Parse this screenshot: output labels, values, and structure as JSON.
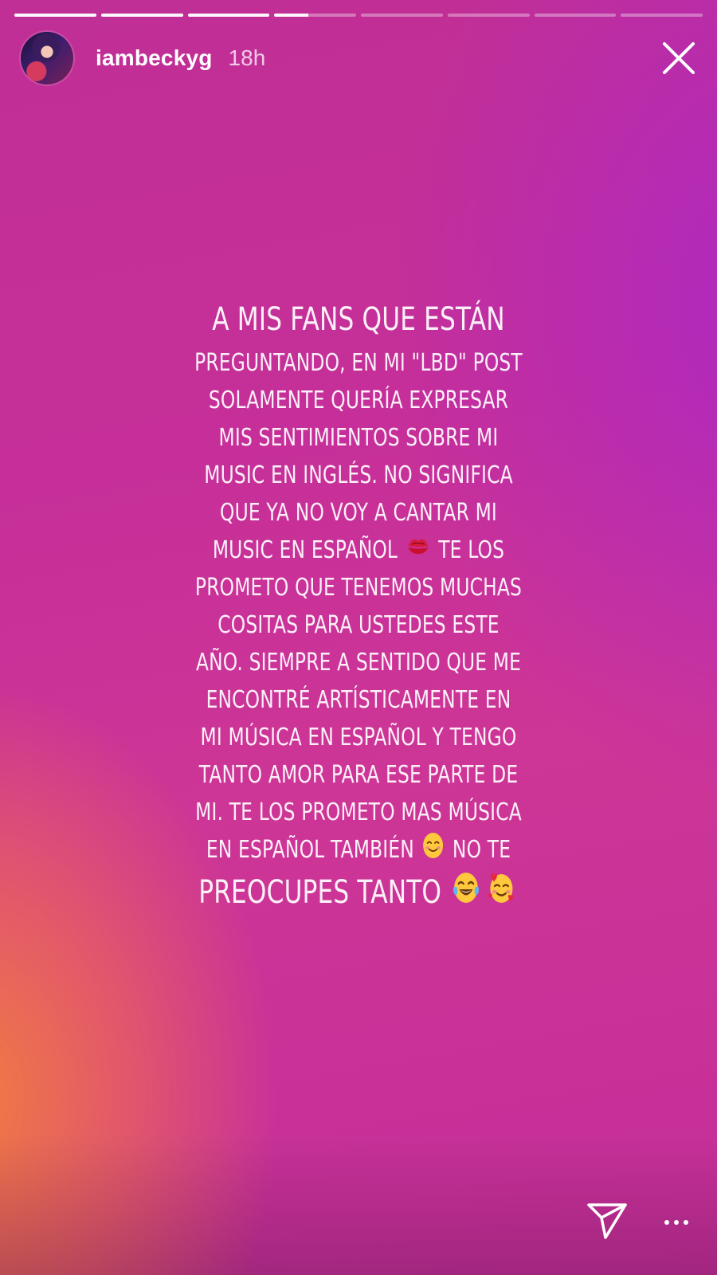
{
  "story": {
    "progress": {
      "segments": 8,
      "current_index": 3,
      "current_fraction": 0.42
    },
    "header": {
      "username": "iambeckyg",
      "time_ago": "18h"
    },
    "text_lines": [
      "A MIS FANS QUE ESTÁN",
      "PREGUNTANDO, EN MI \"LBD\" POST",
      "SOLAMENTE QUERÍA EXPRESAR",
      "MIS SENTIMIENTOS SOBRE MI",
      "MUSIC EN INGLÉS. NO SIGNIFICA",
      "QUE YA NO VOY A CANTAR MI",
      "MUSIC EN ESPAÑOL",
      "TE LOS",
      "PROMETO QUE TENEMOS MUCHAS",
      "COSITAS PARA USTEDES ESTE",
      "AÑO. SIEMPRE A SENTIDO QUE ME",
      "ENCONTRÉ ARTÍSTICAMENTE EN",
      "MI MÚSICA EN ESPAÑOL Y TENGO",
      "TANTO AMOR PARA ESE PARTE DE",
      "MI. TE LOS PROMETO MAS MÚSICA",
      "EN ESPAÑOL TAMBIÉN",
      "NO TE",
      "PREOCUPES TANTO"
    ],
    "emojis": {
      "kiss": "kiss-mark-icon",
      "smiling": "smiling-face-icon",
      "laughing": "tears-of-joy-icon",
      "hearts": "smiling-face-with-hearts-icon"
    },
    "colors": {
      "gradient_magenta": "#c62f99",
      "gradient_orange": "#f5803c",
      "gradient_purple": "#aa28c8"
    }
  }
}
